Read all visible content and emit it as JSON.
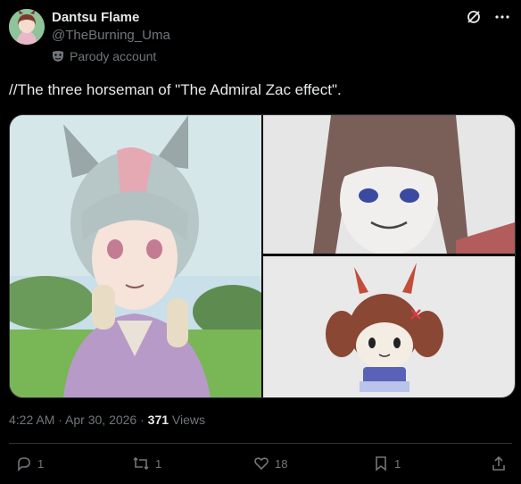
{
  "author": {
    "display_name": "Dantsu Flame",
    "handle": "@TheBurning_Uma",
    "label": "Parody account"
  },
  "tweet": {
    "text": "//The three horseman of \"The Admiral Zac effect\"."
  },
  "meta": {
    "time": "4:22 AM",
    "separator1": " · ",
    "date": "Apr 30, 2026",
    "separator2": " · ",
    "views_count": "371",
    "views_label": " Views"
  },
  "actions": {
    "replies": "1",
    "reposts": "1",
    "likes": "18",
    "bookmarks": "1"
  },
  "colors": {
    "background": "#000000",
    "text": "#e7e9ea",
    "muted": "#71767b",
    "divider": "#2f3336"
  }
}
